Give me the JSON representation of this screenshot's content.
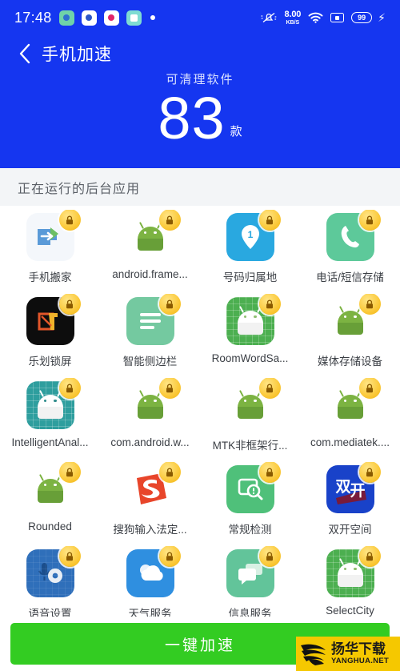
{
  "statusbar": {
    "time": "17:48",
    "tray_icons": [
      "messenger-icon",
      "camera-icon",
      "record-icon",
      "calendar-icon",
      "more-dot-icon"
    ],
    "mute_icon": "bell-muted-icon",
    "net_speed_value": "8.00",
    "net_speed_unit": "KB/S",
    "wifi_icon": "wifi-icon",
    "sim_icon": "sim-card-icon",
    "battery_level": "99",
    "charging_icon": "lightning-bolt-icon"
  },
  "navbar": {
    "back_icon": "chevron-left-icon",
    "title": "手机加速"
  },
  "hero": {
    "label": "可清理软件",
    "count": "83",
    "unit": "款"
  },
  "section": {
    "title": "正在运行的后台应用"
  },
  "colors": {
    "header_blue": "#1536f0",
    "cta_green": "#33cc22",
    "watermark_yellow": "#f5c800",
    "page_bg": "#f3f5f7"
  },
  "apps": [
    {
      "label": "手机搬家",
      "icon": "phone-transfer-icon",
      "badge": "lock-icon"
    },
    {
      "label": "android.frame...",
      "icon": "android-robot-icon",
      "badge": "lock-icon"
    },
    {
      "label": "号码归属地",
      "icon": "location-pin-icon",
      "badge": "lock-icon"
    },
    {
      "label": "电话/短信存储",
      "icon": "phone-handset-icon",
      "badge": "lock-icon"
    },
    {
      "label": "乐划锁屏",
      "icon": "lock-screen-app-icon",
      "badge": "lock-icon"
    },
    {
      "label": "智能侧边栏",
      "icon": "sidebar-list-icon",
      "badge": "lock-icon"
    },
    {
      "label": "RoomWordSa...",
      "icon": "android-robot-grid-icon",
      "badge": "lock-icon"
    },
    {
      "label": "媒体存储设备",
      "icon": "android-robot-icon",
      "badge": "lock-icon"
    },
    {
      "label": "IntelligentAnal...",
      "icon": "android-robot-grid-teal-icon",
      "badge": "lock-icon"
    },
    {
      "label": "com.android.w...",
      "icon": "android-robot-icon",
      "badge": "lock-icon"
    },
    {
      "label": "MTK非框架行...",
      "icon": "android-robot-icon",
      "badge": "lock-icon"
    },
    {
      "label": "com.mediatek....",
      "icon": "android-robot-icon",
      "badge": "lock-icon"
    },
    {
      "label": "Rounded",
      "icon": "android-robot-icon",
      "badge": "lock-icon"
    },
    {
      "label": "搜狗输入法定...",
      "icon": "sogou-input-icon",
      "badge": "lock-icon"
    },
    {
      "label": "常规检测",
      "icon": "scan-detect-icon",
      "badge": "lock-icon"
    },
    {
      "label": "双开空间",
      "icon": "dual-app-icon",
      "badge": "lock-icon"
    },
    {
      "label": "语音设置",
      "icon": "voice-settings-icon",
      "badge": "lock-icon"
    },
    {
      "label": "天气服务",
      "icon": "weather-cloud-icon",
      "badge": "lock-icon"
    },
    {
      "label": "信息服务",
      "icon": "message-bubble-icon",
      "badge": "lock-icon"
    },
    {
      "label": "SelectCity",
      "icon": "android-robot-grid-icon",
      "badge": "lock-icon"
    }
  ],
  "cta": {
    "label": "一键加速"
  },
  "watermark": {
    "cn": "扬华下载",
    "en": "YANGHUA.NET",
    "logo": "eagle-logo-icon"
  }
}
